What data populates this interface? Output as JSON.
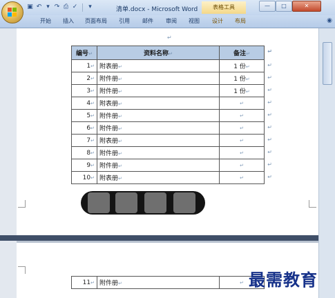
{
  "window": {
    "title": "清单.docx - Microsoft Word",
    "context_tab_group": "表格工具",
    "minimize_glyph": "—",
    "maximize_glyph": "□",
    "close_glyph": "✕"
  },
  "quick_access": {
    "icons": [
      "save-icon",
      "undo-icon",
      "redo-icon",
      "print-preview-icon",
      "customize-icon"
    ]
  },
  "tabs": [
    {
      "label": "开始"
    },
    {
      "label": "插入"
    },
    {
      "label": "页面布局"
    },
    {
      "label": "引用"
    },
    {
      "label": "邮件"
    },
    {
      "label": "审阅"
    },
    {
      "label": "视图"
    },
    {
      "label": "设计"
    },
    {
      "label": "布局"
    }
  ],
  "paragraph_mark": "↵",
  "table": {
    "headers": {
      "num": "编号",
      "name": "资料名称",
      "note": "备注"
    },
    "rows": [
      {
        "num": "1",
        "name": "附表册",
        "note": "1 份"
      },
      {
        "num": "2",
        "name": "附件册",
        "note": "1 份"
      },
      {
        "num": "3",
        "name": "附件册",
        "note": "1 份"
      },
      {
        "num": "4",
        "name": "附表册",
        "note": ""
      },
      {
        "num": "5",
        "name": "附件册",
        "note": ""
      },
      {
        "num": "6",
        "name": "附件册",
        "note": ""
      },
      {
        "num": "7",
        "name": "附表册",
        "note": ""
      },
      {
        "num": "8",
        "name": "附件册",
        "note": ""
      },
      {
        "num": "9",
        "name": "附件册",
        "note": ""
      },
      {
        "num": "10",
        "name": "附表册",
        "note": ""
      }
    ],
    "continued_rows": [
      {
        "num": "11",
        "name": "附件册",
        "note": ""
      }
    ]
  },
  "watermark": "最需教育"
}
